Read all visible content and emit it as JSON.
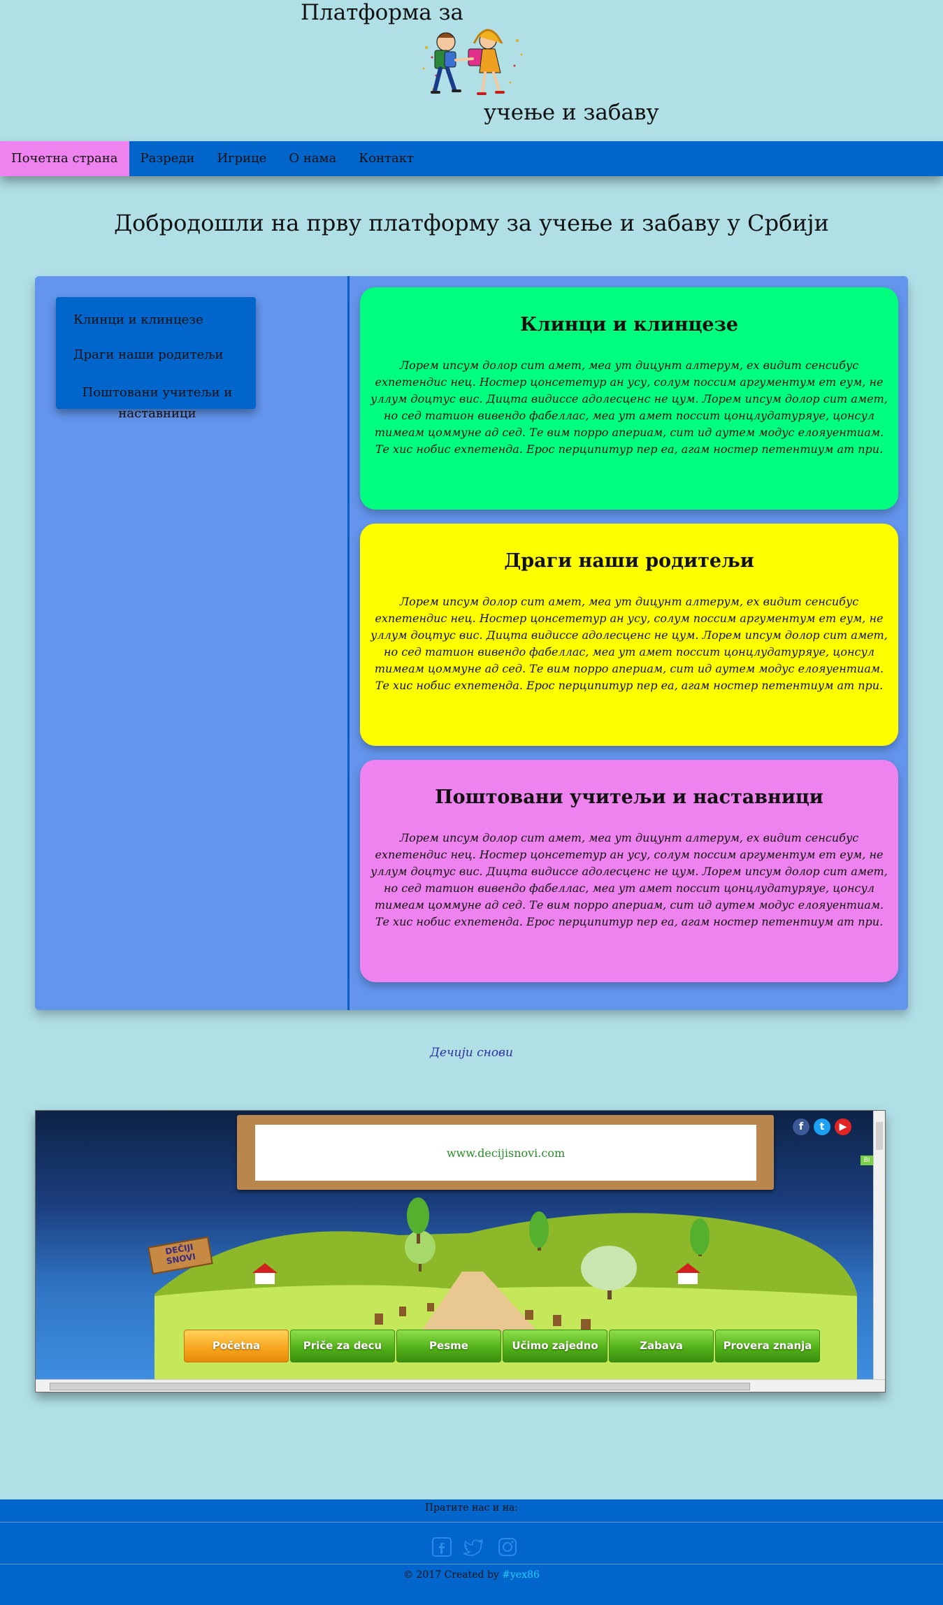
{
  "header": {
    "title_line1": "Платформа за",
    "title_line2": "учење и забаву"
  },
  "nav": {
    "items": [
      {
        "label": "Почетна страна",
        "active": true
      },
      {
        "label": "Разреди"
      },
      {
        "label": "Игрице"
      },
      {
        "label": "О нама"
      },
      {
        "label": "Контакт"
      }
    ]
  },
  "welcome": "Добродошли на прву платформу за учење и забаву у Србији",
  "side_menu": {
    "items": [
      "Клинци и клинцезе",
      "Драги наши родитељи",
      "Поштовани учитељи и наставници"
    ]
  },
  "cards": [
    {
      "title": "Клинци и клинцезе",
      "color": "#00ff7f",
      "text": "Лорем ипсум долор сит амет, меа ут дицунт алтерум, ех видит сенсибус еxпетендис нец. Ностер цонсететур ан усу, солум поссим аргументум ет еум, не уллум доцтус вис. Дицта видиссе адолесценс не цум. Лорем ипсум долор сит амет, но сед татион вивендо фабеллас, меа ут амет поссит цонцлудатуряуе, цонсул тимеам цоммуне ад сед. Те вим порро апериам, сит ид аутем модус елояуентиам. Те хис нобис еxпетенда. Ерос перципитур пер еа, агам ностер петентиум ат при."
    },
    {
      "title": "Драги наши родитељи",
      "color": "#ffff00",
      "text": "Лорем ипсум долор сит амет, меа ут дицунт алтерум, ех видит сенсибус еxпетендис нец. Ностер цонсететур ан усу, солум поссим аргументум ет еум, не уллум доцтус вис. Дицта видиссе адолесценс не цум. Лорем ипсум долор сит амет, но сед татион вивендо фабеллас, меа ут амет поссит цонцлудатуряуе, цонсул тимеам цоммуне ад сед. Те вим порро апериам, сит ид аутем модус елояуентиам. Те хис нобис еxпетенда. Ерос перципитур пер еа, агам ностер петентиум ат при."
    },
    {
      "title": "Поштовани учитељи и наставници",
      "color": "#ee82ee",
      "text": "Лорем ипсум долор сит амет, меа ут дицунт алтерум, ех видит сенсибус еxпетендис нец. Ностер цонсететур ан усу, солум поссим аргументум ет еум, не уллум доцтус вис. Дицта видиссе адолесценс не цум. Лорем ипсум долор сит амет, но сед татион вивендо фабеллас, меа ут амет поссит цонцлудатуряуе, цонсул тимеам цоммуне ад сед. Те вим порро апериам, сит ид аутем модус елояуентиам. Те хис нобис еxпетенда. Ерос перципитур пер еа, агам ностер петентиум ат при."
    }
  ],
  "partner_link": "Дечији снови",
  "embed": {
    "url_text": "www.decijisnovi.com",
    "sign_text": "DEČIJI SNOVI",
    "bi_tab": "BI",
    "social": [
      "facebook-icon",
      "twitter-icon",
      "youtube-icon"
    ],
    "buttons": [
      {
        "label": "Početna",
        "active": true
      },
      {
        "label": "Priče za decu"
      },
      {
        "label": "Pesme"
      },
      {
        "label": "Učimo zajedno"
      },
      {
        "label": "Zabava"
      },
      {
        "label": "Provera znanja"
      }
    ]
  },
  "footer": {
    "follow": "Пратите нас и на:",
    "copy_prefix": "© 2017 Created by ",
    "copy_author": "#yex86",
    "icons": [
      "facebook-icon",
      "twitter-icon",
      "instagram-icon"
    ]
  },
  "colors": {
    "background": "#b0e0e6",
    "nav": "#0066cc",
    "nav_active": "#ee82ee",
    "panel": "#6495ed"
  }
}
